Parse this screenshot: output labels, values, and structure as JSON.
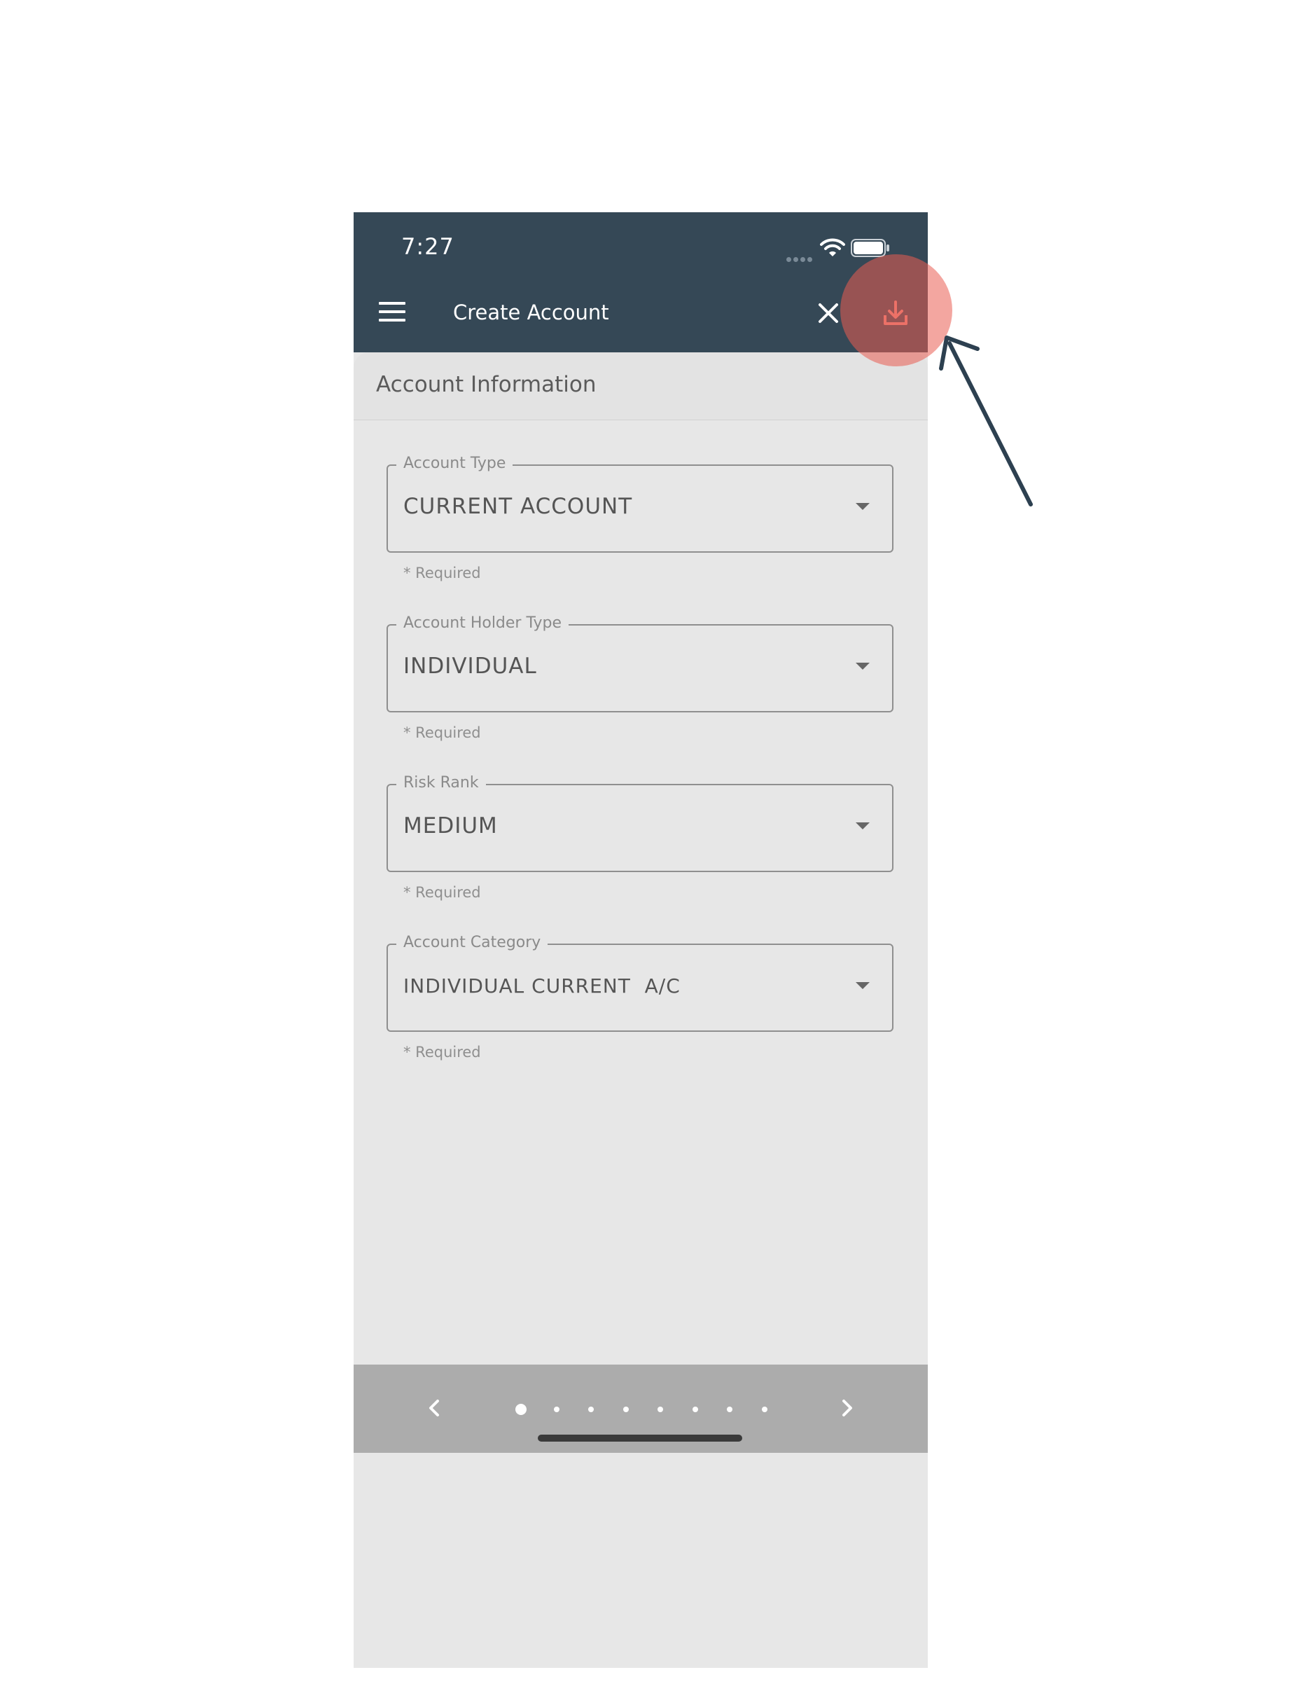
{
  "status_bar": {
    "time": "7:27"
  },
  "app_bar": {
    "title": "Create Account",
    "menu_icon": "hamburger-menu-icon",
    "close_icon": "close-icon",
    "save_icon": "download-save-icon"
  },
  "section": {
    "title": "Account Information"
  },
  "fields": [
    {
      "label": "Account Type",
      "value": "CURRENT ACCOUNT",
      "helper": "* Required"
    },
    {
      "label": "Account Holder Type",
      "value": "INDIVIDUAL",
      "helper": "* Required"
    },
    {
      "label": "Risk Rank",
      "value": "MEDIUM",
      "helper": "* Required"
    },
    {
      "label": "Account Category",
      "value": "INDIVIDUAL CURRENT  A/C",
      "helper": "* Required"
    }
  ],
  "pager": {
    "total_pages": 8,
    "current_page": 1
  },
  "colors": {
    "app_bar": "#354856",
    "content_background": "#e7e7e7",
    "bottom_bar": "#acacac",
    "highlight": "#ea5c52",
    "annotation_arrow": "#2d4050"
  }
}
